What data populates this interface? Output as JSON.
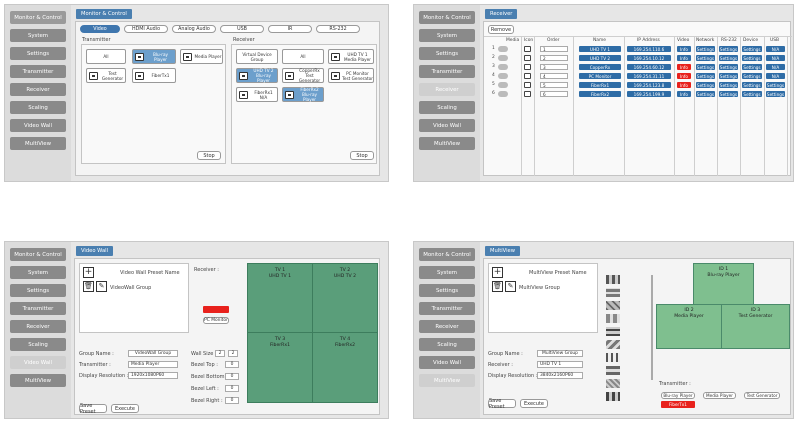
{
  "sidebar": [
    "Monitor & Control",
    "System",
    "Settings",
    "Transmitter",
    "Receiver",
    "Scaling",
    "Video Wall",
    "MultiView"
  ],
  "q1": {
    "title": "Monitor & Control",
    "tabs": [
      "Video",
      "HDMI Audio",
      "Analog Audio",
      "USB",
      "IR",
      "RS-232"
    ],
    "tx_title": "Transmitter",
    "rx_title": "Receiver",
    "tx_all": "All",
    "tx_devices": [
      "Blu-ray Player",
      "Media Player",
      "Test Generator",
      "FiberTx1"
    ],
    "rx_virtual": "Virtual Device Group",
    "rx_all": "All",
    "rx_devices": [
      {
        "name": "UHD TV 1",
        "src": "Media Player"
      },
      {
        "name": "UHD TV 2",
        "src": "Blu-ray Player"
      },
      {
        "name": "CopperRx",
        "src": "Test Generator"
      },
      {
        "name": "PC Monitor",
        "src": "Test Generator"
      },
      {
        "name": "FiberRx1",
        "src": "N/A"
      },
      {
        "name": "FiberRx2",
        "src": "Blu-ray Player"
      }
    ],
    "stop": "Stop"
  },
  "q2": {
    "title": "Receiver",
    "remove": "Remove",
    "headers": [
      "Media",
      "Icon",
      "Order",
      "Name",
      "IP Address",
      "Video",
      "Network",
      "RS-232",
      "Device",
      "USB"
    ],
    "rows": [
      {
        "n": "1",
        "order": "1",
        "name": "UHD TV 1",
        "ip": "169.254.110.6",
        "video": "Info",
        "net": "Settings",
        "rs": "Settings",
        "dev": "Settings",
        "usb": "N/A",
        "vred": false
      },
      {
        "n": "2",
        "order": "2",
        "name": "UHD TV 2",
        "ip": "169.254.10.12",
        "video": "Info",
        "net": "Settings",
        "rs": "Settings",
        "dev": "Settings",
        "usb": "N/A",
        "vred": false
      },
      {
        "n": "3",
        "order": "3",
        "name": "CopperRx",
        "ip": "169.254.60.12",
        "video": "Info",
        "net": "Settings",
        "rs": "Settings",
        "dev": "Settings",
        "usb": "N/A",
        "vred": true
      },
      {
        "n": "4",
        "order": "4",
        "name": "PC Monitor",
        "ip": "169.254.31.11",
        "video": "Info",
        "net": "Settings",
        "rs": "Settings",
        "dev": "Settings",
        "usb": "N/A",
        "vred": true
      },
      {
        "n": "5",
        "order": "5",
        "name": "FiberRx1",
        "ip": "169.254.123.8",
        "video": "Info",
        "net": "Settings",
        "rs": "Settings",
        "dev": "Settings",
        "usb": "Settings",
        "vred": true
      },
      {
        "n": "6",
        "order": "6",
        "name": "FiberRx2",
        "ip": "169.254.199.9",
        "video": "Info",
        "net": "Settings",
        "rs": "Settings",
        "dev": "Settings",
        "usb": "Settings",
        "vred": false
      }
    ]
  },
  "q3": {
    "title": "Video Wall",
    "preset_header": "Video Wall Preset Name",
    "preset_item": "VideoWall Group",
    "receiver_label": "Receiver :",
    "pc_monitor": "PC Monitor",
    "group_name_label": "Group Name :",
    "group_name_value": "VideoWall Group",
    "transmitter_label": "Transmitter :",
    "transmitter_value": "Media Player",
    "resolution_label": "Display Resolution :",
    "resolution_value": "1920x1080P60",
    "wall_size_label": "Wall Size :",
    "wall_w": "2",
    "wall_h": "2",
    "bezel": [
      {
        "label": "Bezel Top :",
        "value": "0"
      },
      {
        "label": "Bezel Bottom :",
        "value": "0"
      },
      {
        "label": "Bezel Left :",
        "value": "0"
      },
      {
        "label": "Bezel Right :",
        "value": "0"
      }
    ],
    "save": "Save Preset",
    "execute": "Execute",
    "cells": [
      {
        "title": "TV 1",
        "sub": "UHD TV 1"
      },
      {
        "title": "TV 2",
        "sub": "UHD TV 2"
      },
      {
        "title": "TV 3",
        "sub": "FiberRx1"
      },
      {
        "title": "TV 4",
        "sub": "FiberRx2"
      }
    ]
  },
  "q4": {
    "title": "MultiView",
    "preset_header": "MultiView Preset Name",
    "preset_item": "MultiView Group",
    "group_name_label": "Group Name :",
    "group_name_value": "MultiView Group",
    "receiver_label": "Receiver :",
    "receiver_value": "UHD TV 1",
    "resolution_label": "Display Resolution :",
    "resolution_value": "3840x2160P60",
    "save": "Save Preset",
    "execute": "Execute",
    "cells": [
      {
        "title": "ID 1",
        "sub": "Blu-ray Player"
      },
      {
        "title": "ID 2",
        "sub": "Media Player"
      },
      {
        "title": "ID 3",
        "sub": "Test Generator"
      }
    ],
    "tx_label": "Transmitter :",
    "tx_buttons": [
      "Blu-ray Player",
      "Media Player",
      "Test Generator"
    ],
    "tx_red": "FiberTx1"
  },
  "colors": {
    "accent": "#2e6ca6",
    "alert": "#e8211c",
    "wall": "#5a9e7a"
  }
}
